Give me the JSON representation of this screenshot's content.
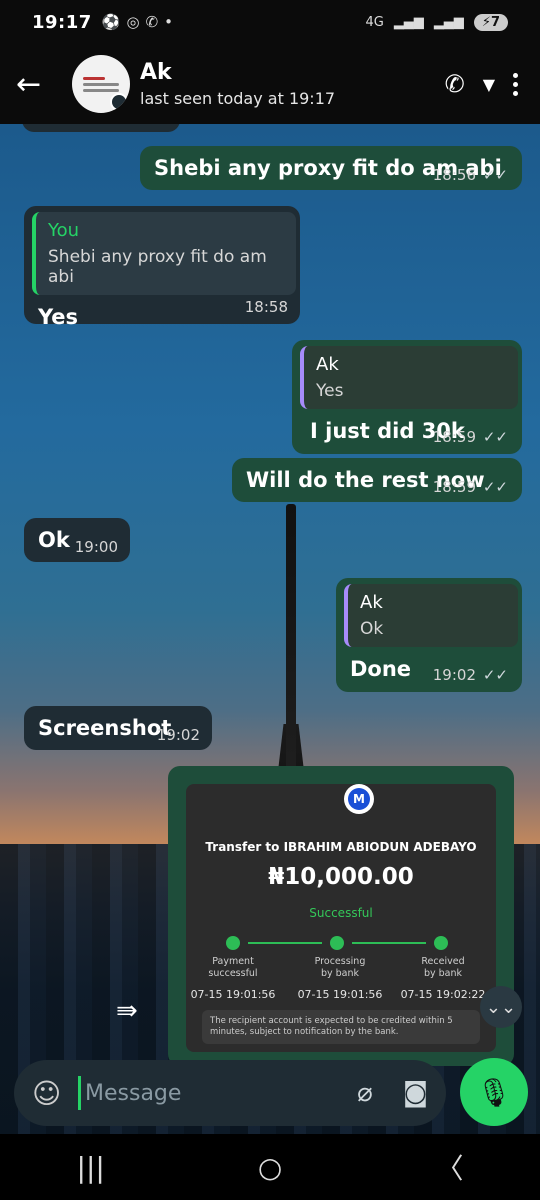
{
  "status_bar": {
    "time": "19:17",
    "network": "4G",
    "battery": "7"
  },
  "header": {
    "contact_name": "Ak",
    "last_seen": "last seen today at 19:17"
  },
  "messages": [
    {
      "text": "Shebi any proxy fit do am abi",
      "time": "18:56"
    },
    {
      "quote_name": "You",
      "quote_text": "Shebi any proxy fit do am abi",
      "text": "Yes",
      "time": "18:58"
    },
    {
      "quote_name": "Ak",
      "quote_text": "Yes",
      "text": "I just did 30k",
      "time": "18:59"
    },
    {
      "text": "Will do the rest now",
      "time": "18:59"
    },
    {
      "text": "Ok",
      "time": "19:00"
    },
    {
      "quote_name": "Ak",
      "quote_text": "Ok",
      "text": "Done",
      "time": "19:02"
    },
    {
      "text": "Screenshot",
      "time": "19:02"
    }
  ],
  "receipt": {
    "logo_letter": "M",
    "title": "Transfer to IBRAHIM ABIODUN ADEBAYO",
    "amount": "₦10,000.00",
    "status": "Successful",
    "steps": [
      {
        "label_1": "Payment",
        "label_2": "successful",
        "time": "07-15 19:01:56"
      },
      {
        "label_1": "Processing",
        "label_2": "by bank",
        "time": "07-15 19:01:56"
      },
      {
        "label_1": "Received",
        "label_2": "by bank",
        "time": "07-15 19:02:22"
      }
    ],
    "notice": "The recipient account is expected to be credited within 5 minutes, subject to notification by the bank."
  },
  "composer": {
    "placeholder": "Message"
  },
  "colors": {
    "incoming_bubble": "#1f2c34",
    "outgoing_bubble": "#1e4d3a",
    "accent_green": "#25d366",
    "quote_green": "#25d366",
    "quote_purple": "#a78bfa"
  }
}
